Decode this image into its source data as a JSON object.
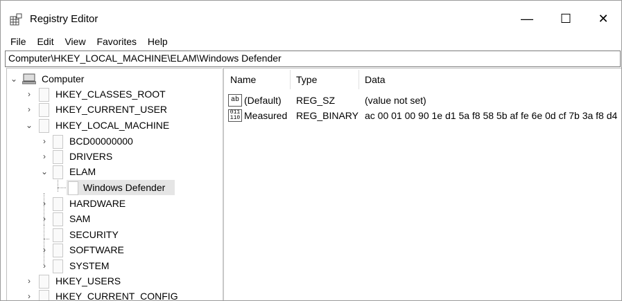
{
  "title_bar": {
    "title": "Registry Editor",
    "minimize": "—",
    "maximize": "☐",
    "close": "✕"
  },
  "menu": [
    "File",
    "Edit",
    "View",
    "Favorites",
    "Help"
  ],
  "address": "Computer\\HKEY_LOCAL_MACHINE\\ELAM\\Windows Defender",
  "tree": [
    {
      "label": "Computer",
      "expanded": true
    },
    {
      "label": "HKEY_CLASSES_ROOT"
    },
    {
      "label": "HKEY_CURRENT_USER"
    },
    {
      "label": "HKEY_LOCAL_MACHINE",
      "expanded": true
    },
    {
      "label": "BCD00000000"
    },
    {
      "label": "DRIVERS"
    },
    {
      "label": "ELAM",
      "expanded": true
    },
    {
      "label": "Windows Defender",
      "selected": true
    },
    {
      "label": "HARDWARE"
    },
    {
      "label": "SAM"
    },
    {
      "label": "SECURITY"
    },
    {
      "label": "SOFTWARE"
    },
    {
      "label": "SYSTEM"
    },
    {
      "label": "HKEY_USERS"
    },
    {
      "label": "HKEY_CURRENT_CONFIG"
    }
  ],
  "columns": {
    "name": "Name",
    "type": "Type",
    "data": "Data"
  },
  "values": [
    {
      "icon": "string-value-icon",
      "icon_text": "ab",
      "name": "(Default)",
      "type": "REG_SZ",
      "data": "(value not set)"
    },
    {
      "icon": "binary-value-icon",
      "icon_text": "011\n110",
      "name": "Measured",
      "type": "REG_BINARY",
      "data": "ac 00 01 00 90 1e d1 5a f8 58 5b af fe 6e 0d cf 7b 3a f8 d4"
    }
  ]
}
